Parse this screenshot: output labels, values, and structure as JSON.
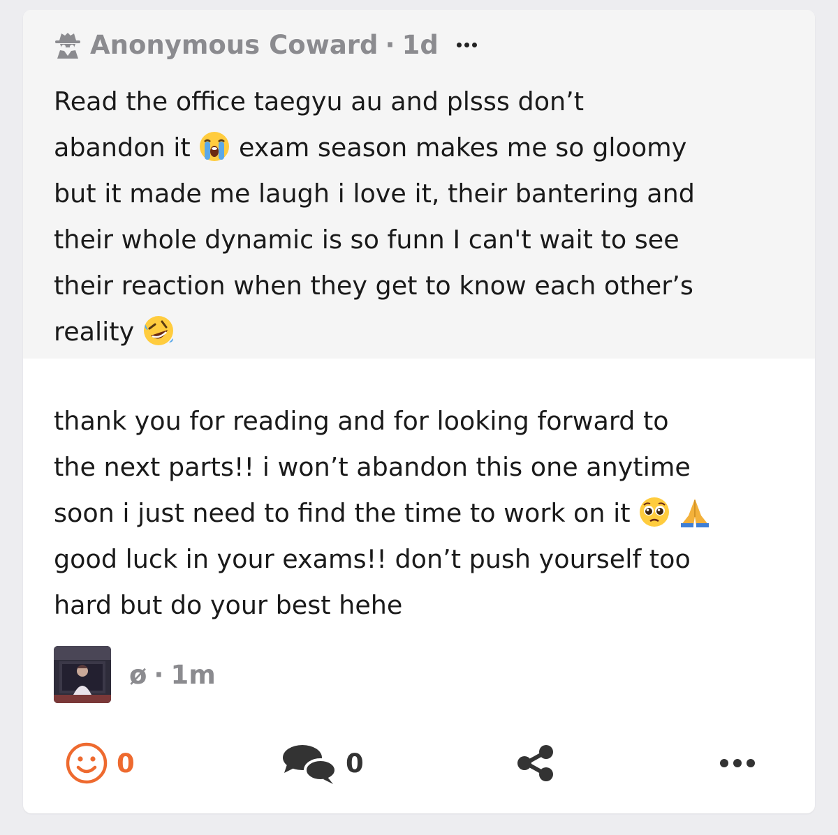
{
  "question": {
    "author": "Anonymous Coward",
    "separator": "·",
    "age": "1d",
    "icon": "anonymous-spy-icon",
    "lines": [
      "Read the office taegyu au and plsss don’t",
      "abandon it",
      "exam season makes me so gloomy",
      "but it made me laugh i love it, their bantering and",
      "their whole dynamic is so funn I can't wait to see",
      "their reaction when they get to know each other’s",
      "reality"
    ],
    "emoji_1": "loudly-crying-face-emoji",
    "emoji_2": "rolling-on-floor-laughing-emoji"
  },
  "answer": {
    "lines": [
      "thank you for reading and for looking forward to",
      "the next parts!! i won’t abandon this one anytime",
      "soon i just need to find the time to work on it",
      "good luck in your exams!! don’t push yourself too",
      "hard but do your best hehe"
    ],
    "emoji_1": "pleading-face-emoji",
    "emoji_2": "folded-hands-emoji"
  },
  "responder": {
    "name": "ø",
    "separator": "·",
    "age": "1m"
  },
  "actions": {
    "reactions_count": "0",
    "comments_count": "0",
    "react_icon": "smiley-icon",
    "comment_icon": "speech-bubbles-icon",
    "share_icon": "share-icon",
    "more_icon": "more-dots-icon"
  },
  "colors": {
    "accent": "#ee6a2f",
    "meta_gray": "#8b8b8f",
    "question_bg": "#f5f5f5",
    "page_bg": "#ededf0"
  }
}
